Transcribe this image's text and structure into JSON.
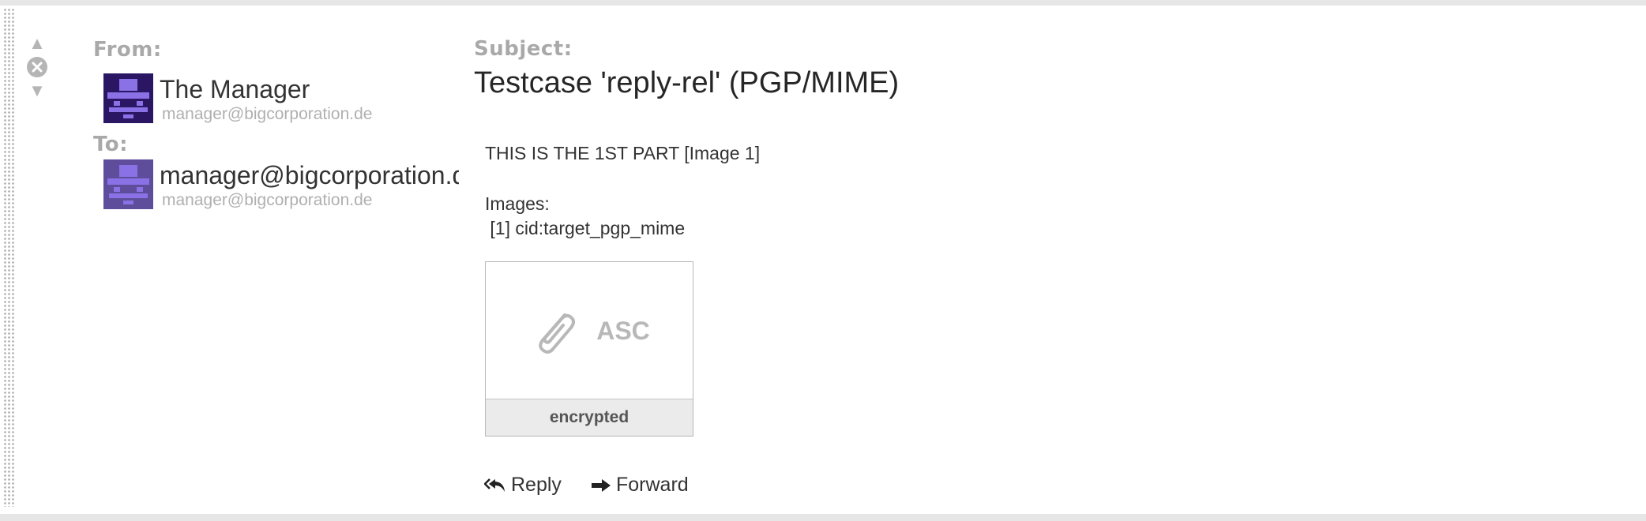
{
  "headers": {
    "from_label": "From:",
    "to_label": "To:",
    "subject_label": "Subject:"
  },
  "from": {
    "name": "The Manager",
    "email": "manager@bigcorporation.de"
  },
  "to": {
    "name": "manager@bigcorporation.de",
    "email": "manager@bigcorporation.de"
  },
  "subject": "Testcase 'reply-rel' (PGP/MIME)",
  "body": {
    "line1": "THIS IS THE 1ST PART [Image 1]",
    "images_heading": "Images:",
    "image_ref": " [1] cid:target_pgp_mime"
  },
  "attachment": {
    "extension": "ASC",
    "caption": "encrypted",
    "icon": "paperclip-icon"
  },
  "actions": {
    "reply_label": "Reply",
    "forward_label": "Forward"
  },
  "colors": {
    "avatar_from_bg": "#2b1664",
    "avatar_to_bg": "#5e4d9a",
    "avatar_glyph": "#8a72e6"
  }
}
